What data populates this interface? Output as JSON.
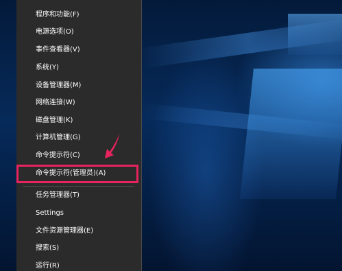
{
  "context_menu": {
    "items": [
      {
        "label": "程序和功能(F)"
      },
      {
        "label": "电源选项(O)"
      },
      {
        "label": "事件查看器(V)"
      },
      {
        "label": "系统(Y)"
      },
      {
        "label": "设备管理器(M)"
      },
      {
        "label": "网络连接(W)"
      },
      {
        "label": "磁盘管理(K)"
      },
      {
        "label": "计算机管理(G)"
      },
      {
        "label": "命令提示符(C)"
      },
      {
        "label": "命令提示符(管理员)(A)"
      },
      {
        "label": "任务管理器(T)"
      },
      {
        "label": "Settings"
      },
      {
        "label": "文件资源管理器(E)"
      },
      {
        "label": "搜索(S)"
      },
      {
        "label": "运行(R)"
      }
    ],
    "highlighted_item": "命令提示符(管理员)(A)"
  },
  "annotation": {
    "highlight_color": "#e8245e",
    "arrow_color": "#e8245e",
    "arrow_icon": "pointer-arrow-icon"
  },
  "colors": {
    "menu_background": "#2b2b2b",
    "desktop_background": "#062a5a"
  }
}
